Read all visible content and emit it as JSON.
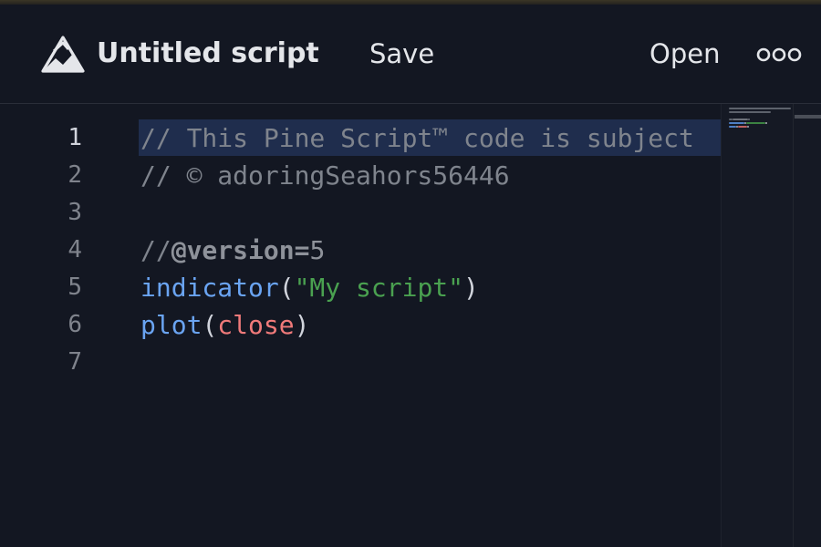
{
  "toolbar": {
    "title": "Untitled script",
    "save_label": "Save",
    "open_label": "Open",
    "logo_icon": "pine-logo-icon",
    "more_icon": "more-dots-icon"
  },
  "editor": {
    "current_line": 1,
    "lines": [
      {
        "number": "1",
        "tokens": [
          {
            "t": "// This Pine Script™ code is subject",
            "k": "comment"
          }
        ]
      },
      {
        "number": "2",
        "tokens": [
          {
            "t": "// © adoringSeahors56446",
            "k": "comment"
          }
        ]
      },
      {
        "number": "3",
        "tokens": []
      },
      {
        "number": "4",
        "tokens": [
          {
            "t": "//",
            "k": "comment"
          },
          {
            "t": "@version=",
            "k": "annot"
          },
          {
            "t": "5",
            "k": "num"
          }
        ]
      },
      {
        "number": "5",
        "tokens": [
          {
            "t": "indicator",
            "k": "func"
          },
          {
            "t": "(",
            "k": "punc"
          },
          {
            "t": "\"My script\"",
            "k": "str"
          },
          {
            "t": ")",
            "k": "punc"
          }
        ]
      },
      {
        "number": "6",
        "tokens": [
          {
            "t": "plot",
            "k": "func"
          },
          {
            "t": "(",
            "k": "punc"
          },
          {
            "t": "close",
            "k": "var"
          },
          {
            "t": ")",
            "k": "punc"
          }
        ]
      },
      {
        "number": "7",
        "tokens": []
      }
    ]
  },
  "colors": {
    "background": "#131722",
    "comment": "#7f848d",
    "function": "#6aa4f2",
    "string": "#4aa150",
    "variable": "#f07a7a",
    "current_line_highlight": "#1f2d4d"
  }
}
